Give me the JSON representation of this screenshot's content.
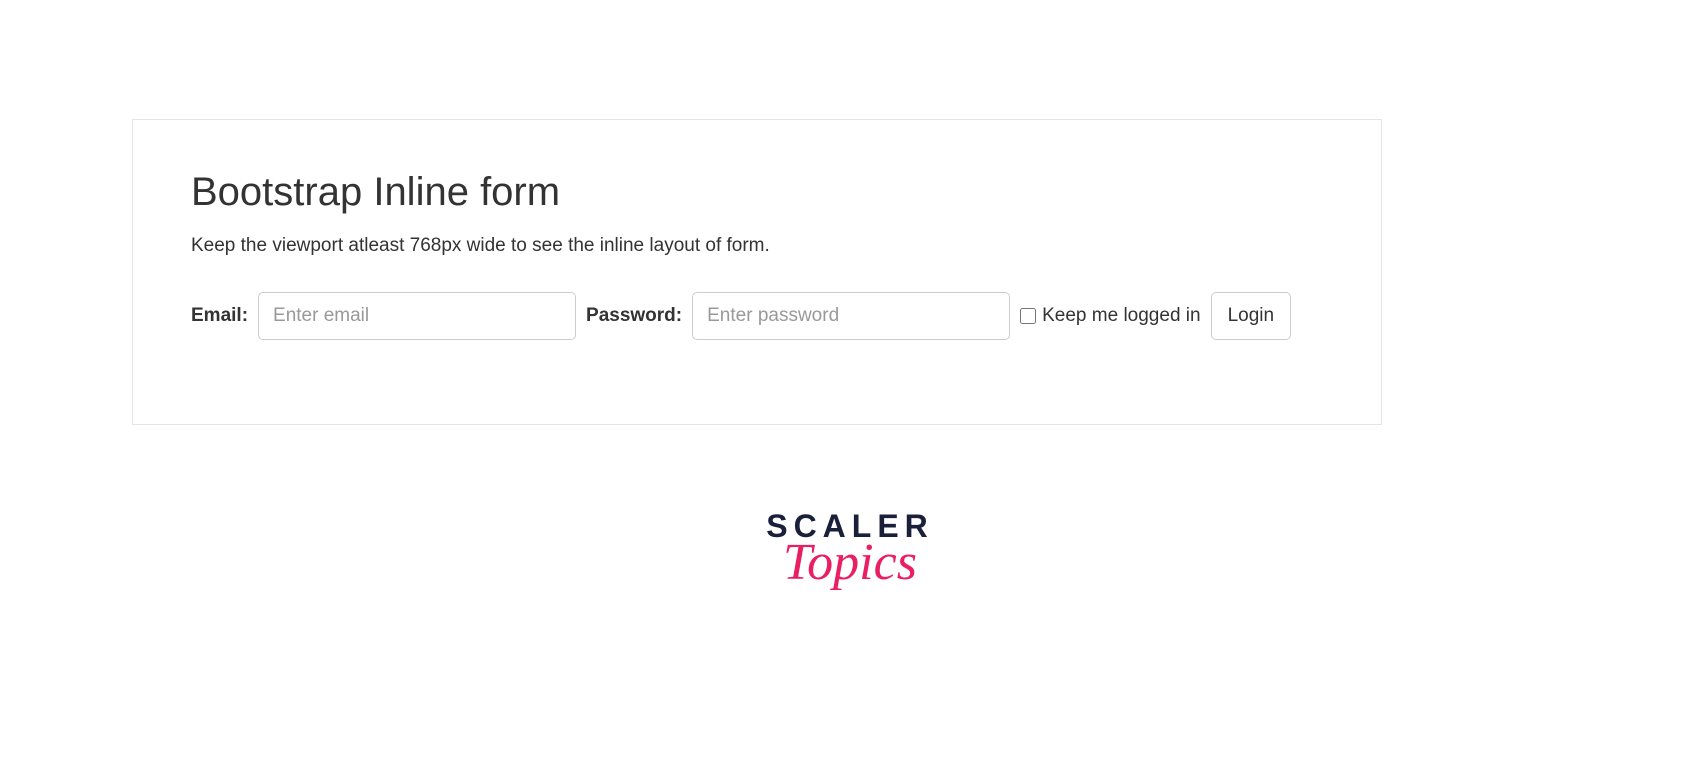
{
  "panel": {
    "heading": "Bootstrap Inline form",
    "subtext": "Keep the viewport atleast 768px wide to see the inline layout of form."
  },
  "form": {
    "email_label": "Email:",
    "email_placeholder": "Enter email",
    "password_label": "Password:",
    "password_placeholder": "Enter password",
    "checkbox_label": "Keep me logged in",
    "submit_label": "Login"
  },
  "logo": {
    "line1": "SCALER",
    "line2": "Topics"
  }
}
